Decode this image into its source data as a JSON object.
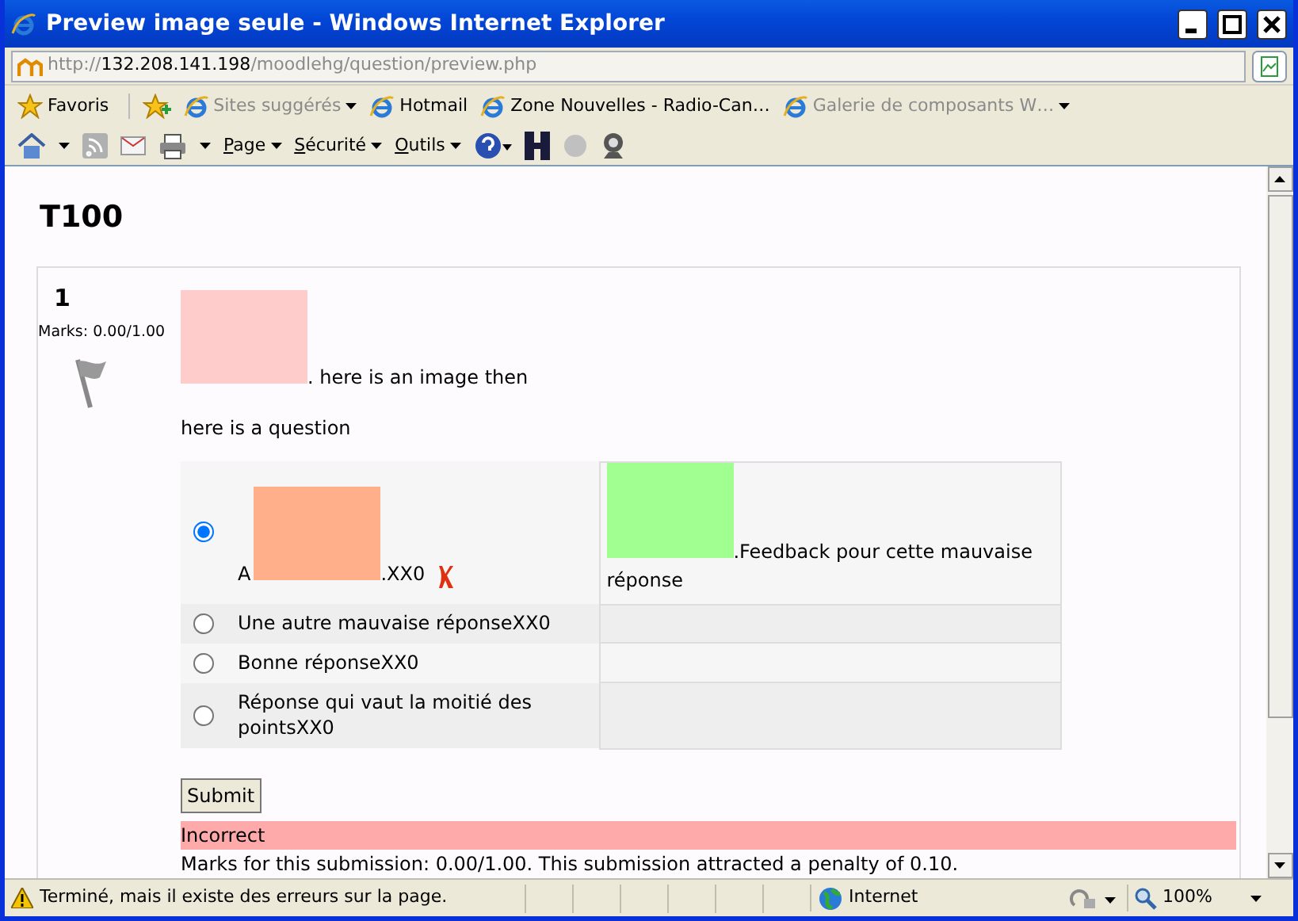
{
  "window": {
    "title": "Preview image seule - Windows Internet Explorer"
  },
  "address": {
    "scheme": "http://",
    "host": "132.208.141.198",
    "path": "/moodlehg/question/preview.php"
  },
  "favorites_bar": {
    "favorites_button": "Favoris",
    "links": [
      {
        "label": "Sites suggérés",
        "dimmed": true,
        "dropdown": true
      },
      {
        "label": "Hotmail",
        "dimmed": false,
        "dropdown": false
      },
      {
        "label": "Zone Nouvelles - Radio-Can…",
        "dimmed": false,
        "dropdown": false
      },
      {
        "label": "Galerie de composants W…",
        "dimmed": true,
        "dropdown": true
      }
    ]
  },
  "command_bar": {
    "menus": [
      "Page",
      "Sécurité",
      "Outils"
    ]
  },
  "page": {
    "heading": "T100",
    "question": {
      "number": "1",
      "marks": "Marks: 0.00/1.00",
      "flagged": false,
      "stem_after_image": ". here is an image then",
      "prompt": "here is a question",
      "answers": [
        {
          "text_before_image": "A",
          "text_after_image": ".XX0",
          "selected": true,
          "marked_incorrect": true,
          "feedback": ".Feedback pour cette mauvaise réponse"
        },
        {
          "kind": "text",
          "text": "Une autre mauvaise réponseXX0",
          "selected": false,
          "marked_incorrect": false
        },
        {
          "kind": "text",
          "text": "Bonne réponseXX0",
          "selected": false,
          "marked_incorrect": false
        },
        {
          "kind": "text",
          "text": "Réponse qui vaut la moitié des pointsXX0",
          "selected": false,
          "marked_incorrect": false
        }
      ],
      "submit": "Submit",
      "outcome": "Incorrect",
      "summary": "Marks for this submission: 0.00/1.00. This submission attracted a penalty of 0.10."
    }
  },
  "status_bar": {
    "message": "Terminé, mais il existe des erreurs sur la page.",
    "zone": "Internet",
    "zoom": "100%"
  }
}
